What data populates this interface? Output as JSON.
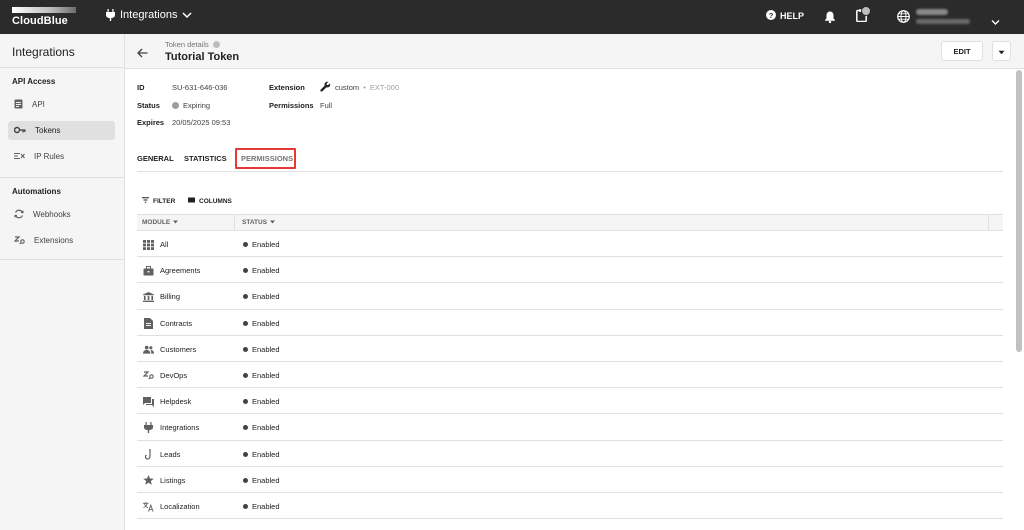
{
  "brand": {
    "logo_text": "CloudBlue"
  },
  "topbar": {
    "app_name": "Integrations",
    "help_label": "HELP"
  },
  "sidebar": {
    "title": "Integrations",
    "sections": [
      {
        "label": "API Access",
        "items": [
          {
            "label": "API"
          },
          {
            "label": "Tokens"
          },
          {
            "label": "IP Rules"
          }
        ]
      },
      {
        "label": "Automations",
        "items": [
          {
            "label": "Webhooks"
          },
          {
            "label": "Extensions"
          }
        ]
      }
    ]
  },
  "header": {
    "breadcrumb": "Token details",
    "title": "Tutorial Token",
    "edit_label": "EDIT"
  },
  "details": {
    "id_label": "ID",
    "id_value": "SU-631-646-036",
    "status_label": "Status",
    "status_value": "Expiring",
    "expires_label": "Expires",
    "expires_value": "20/05/2025 09:53",
    "extension_label": "Extension",
    "extension_name": "custom",
    "extension_sep": "•",
    "extension_id": "EXT-000",
    "permissions_label": "Permissions",
    "permissions_value": "Full"
  },
  "tabs": [
    {
      "label": "GENERAL"
    },
    {
      "label": "STATISTICS"
    },
    {
      "label": "PERMISSIONS"
    }
  ],
  "toolbar": {
    "filter_label": "FILTER",
    "columns_label": "COLUMNS"
  },
  "table": {
    "columns": [
      {
        "label": "MODULE"
      },
      {
        "label": "STATUS"
      }
    ],
    "rows": [
      {
        "module": "All",
        "status": "Enabled",
        "icon": "grid-icon"
      },
      {
        "module": "Agreements",
        "status": "Enabled",
        "icon": "briefcase-icon"
      },
      {
        "module": "Billing",
        "status": "Enabled",
        "icon": "bank-icon"
      },
      {
        "module": "Contracts",
        "status": "Enabled",
        "icon": "document-icon"
      },
      {
        "module": "Customers",
        "status": "Enabled",
        "icon": "people-icon"
      },
      {
        "module": "DevOps",
        "status": "Enabled",
        "icon": "devops-icon"
      },
      {
        "module": "Helpdesk",
        "status": "Enabled",
        "icon": "chat-icon"
      },
      {
        "module": "Integrations",
        "status": "Enabled",
        "icon": "plug-icon"
      },
      {
        "module": "Leads",
        "status": "Enabled",
        "icon": "hook-icon"
      },
      {
        "module": "Listings",
        "status": "Enabled",
        "icon": "star-icon"
      },
      {
        "module": "Localization",
        "status": "Enabled",
        "icon": "translate-icon"
      }
    ]
  }
}
